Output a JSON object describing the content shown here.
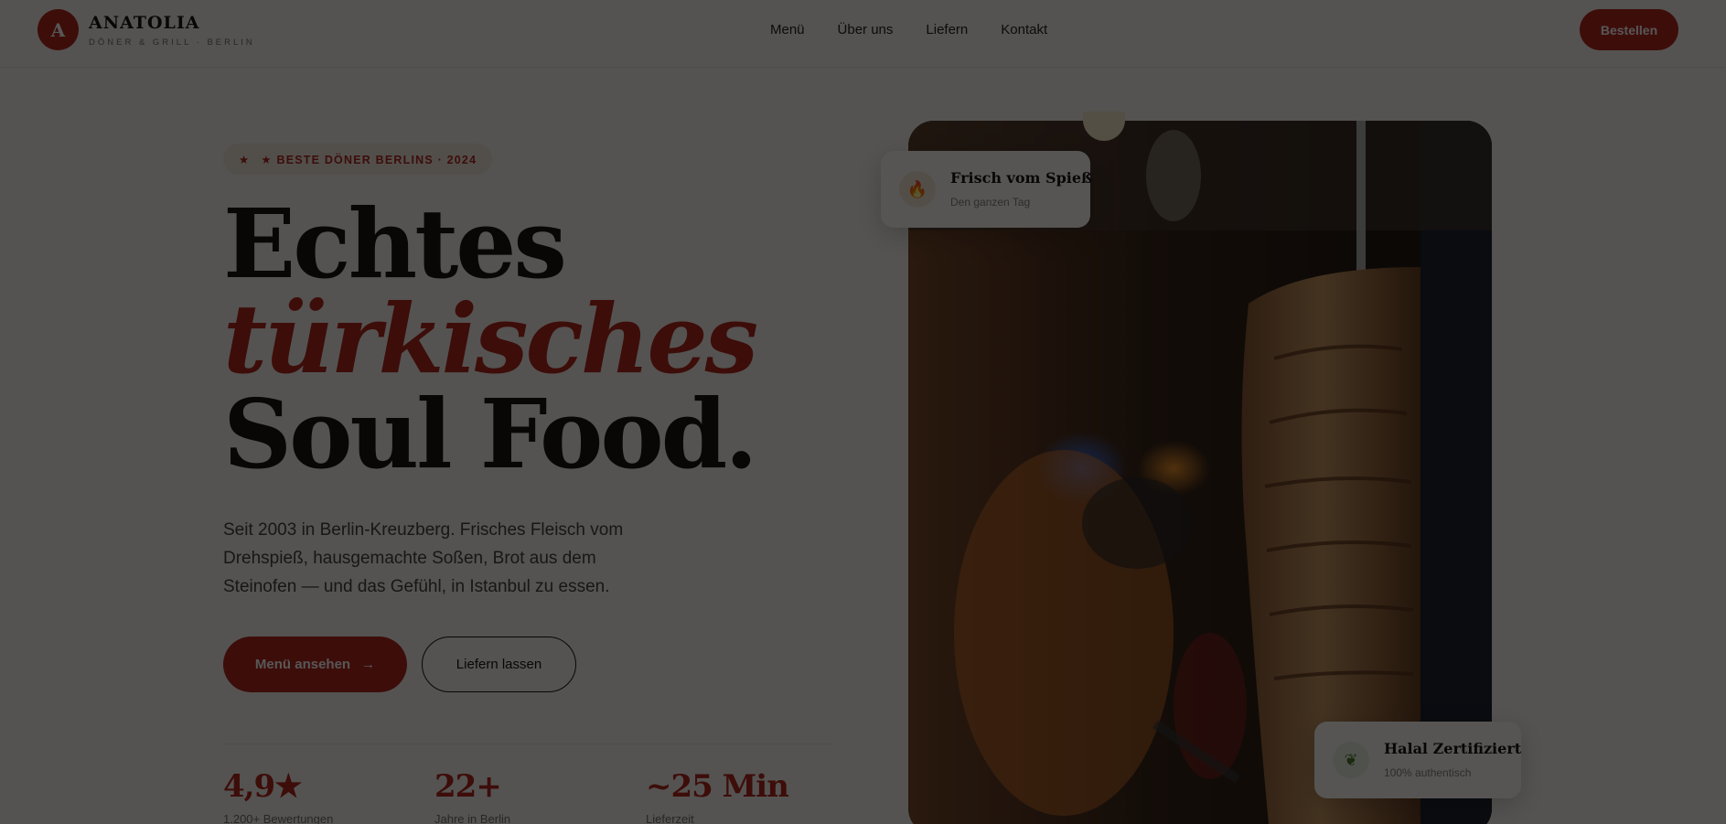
{
  "brand": {
    "logo_letter": "A",
    "name": "ANATOLIA",
    "tagline": "DÖNER & GRILL · BERLIN"
  },
  "nav": {
    "links": [
      "Menü",
      "Über uns",
      "Liefern",
      "Kontakt"
    ],
    "cta": "Bestellen"
  },
  "hero": {
    "badge_icon": "star-icon",
    "badge": "★ BESTE DÖNER BERLINS · 2024",
    "headline": [
      "Echtes",
      "türkisches",
      "Soul Food."
    ],
    "lead": "Seit 2003 in Berlin-Kreuzberg. Frisches Fleisch vom Drehspieß, hausgemachte Soßen, Brot aus dem Steinofen — und das Gefühl, in Istanbul zu essen.",
    "primary_button": "Menü ansehen",
    "primary_button_icon": "arrow-right-icon",
    "secondary_button": "Liefern lassen",
    "stats": [
      {
        "value": "4,9★",
        "label": "1.200+ Bewertungen"
      },
      {
        "value": "22+",
        "label": "Jahre in Berlin"
      },
      {
        "value": "~25 Min",
        "label": "Lieferzeit"
      }
    ]
  },
  "cards": {
    "top": {
      "icon": "flame-icon",
      "title": "Frisch vom Spieß",
      "subtitle": "Den ganzen Tag"
    },
    "bottom": {
      "icon": "leaf-icon",
      "title": "Halal Zertifiziert",
      "subtitle": "100% authentisch"
    }
  },
  "colors": {
    "accent": "#b3261e",
    "background": "#f6f3ee",
    "text": "#1c1412",
    "overlay": "rgba(0,0,0,0.66)"
  }
}
